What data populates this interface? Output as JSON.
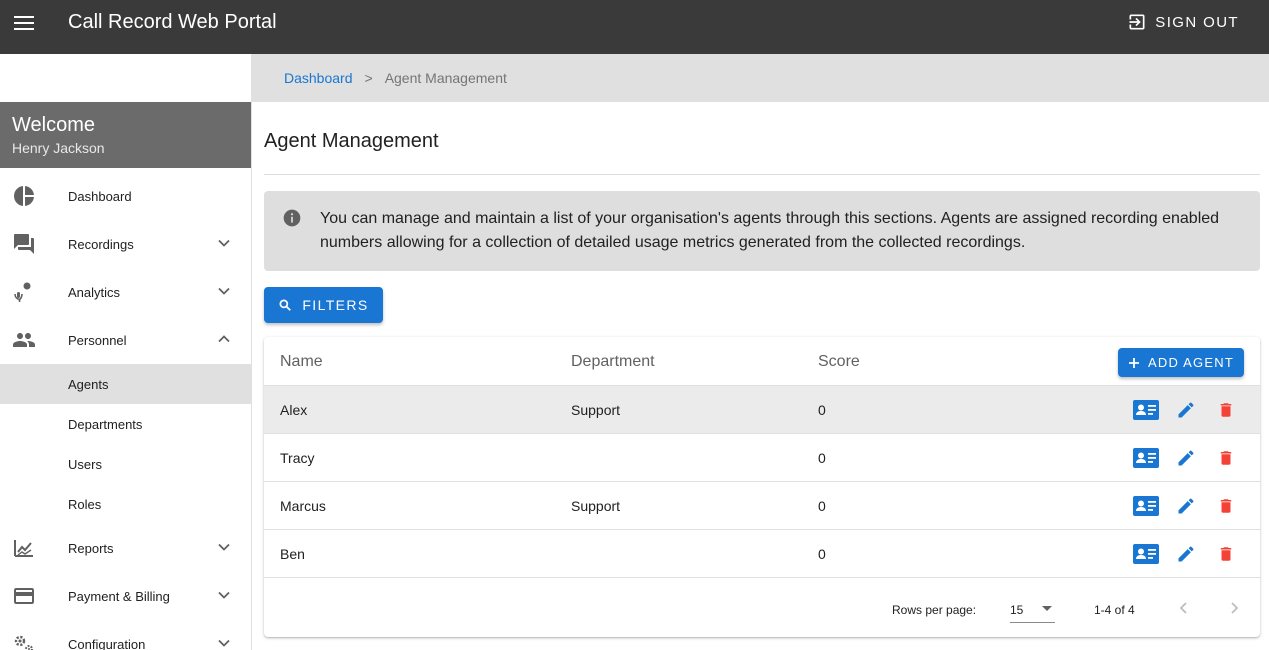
{
  "app": {
    "title": "Call Record Web Portal",
    "signout_label": "SIGN OUT"
  },
  "sidebar": {
    "welcome_title": "Welcome",
    "user_name": "Henry Jackson",
    "items": [
      {
        "label": "Dashboard",
        "icon": "pie-chart-icon"
      },
      {
        "label": "Recordings",
        "icon": "forum-icon",
        "expandable": true,
        "expanded": false
      },
      {
        "label": "Analytics",
        "icon": "record-voice-icon",
        "expandable": true,
        "expanded": false
      },
      {
        "label": "Personnel",
        "icon": "people-icon",
        "expandable": true,
        "expanded": true
      }
    ],
    "personnel_sub": [
      {
        "label": "Agents",
        "active": true
      },
      {
        "label": "Departments"
      },
      {
        "label": "Users"
      },
      {
        "label": "Roles"
      }
    ],
    "items_after": [
      {
        "label": "Reports",
        "icon": "trending-chart-icon",
        "expandable": true
      },
      {
        "label": "Payment & Billing",
        "icon": "credit-card-icon",
        "expandable": true
      },
      {
        "label": "Configuration",
        "icon": "settings-cogs-icon",
        "expandable": true
      }
    ]
  },
  "breadcrumb": {
    "root": "Dashboard",
    "separator": ">",
    "current": "Agent Management"
  },
  "main": {
    "title": "Agent Management",
    "info_text": "You can manage and maintain a list of your organisation's agents through this sections. Agents are assigned recording enabled numbers allowing for a collection of detailed usage metrics generated from the collected recordings.",
    "filters_label": "FILTERS",
    "add_agent_label": "ADD AGENT"
  },
  "table": {
    "columns": [
      "Name",
      "Department",
      "Score"
    ],
    "rows": [
      {
        "name": "Alex",
        "department": "Support",
        "score": "0"
      },
      {
        "name": "Tracy",
        "department": "",
        "score": "0"
      },
      {
        "name": "Marcus",
        "department": "Support",
        "score": "0"
      },
      {
        "name": "Ben",
        "department": "",
        "score": "0"
      }
    ],
    "footer": {
      "rows_per_page_label": "Rows per page:",
      "rows_per_page_value": "15",
      "range_label": "1-4 of 4"
    }
  },
  "colors": {
    "appbar": "#3a3a3a",
    "primary": "#1976d2",
    "delete": "#f44336",
    "welcome_bg": "#6b6b6b",
    "crumb_bg": "#e0e0e0"
  }
}
